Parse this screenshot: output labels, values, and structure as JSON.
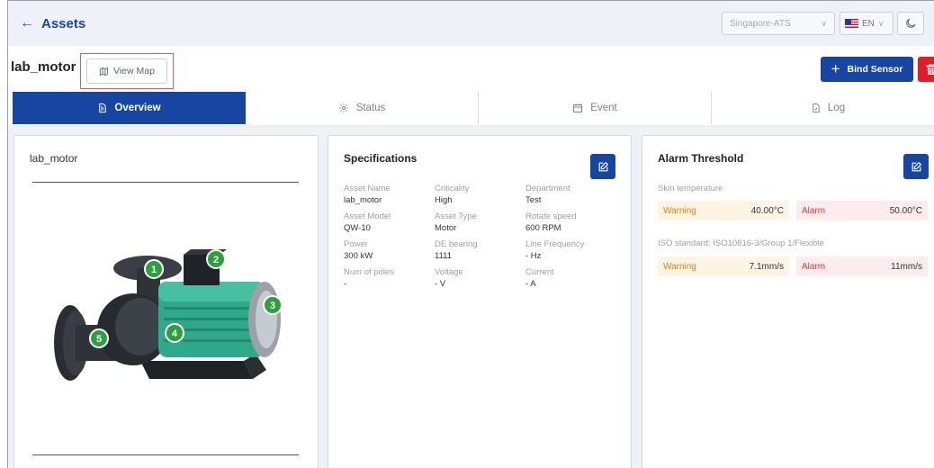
{
  "header": {
    "back_label": "Assets",
    "site_select": "Singapore-ATS",
    "lang_select": "EN"
  },
  "asset": {
    "name": "lab_motor",
    "view_map_label": "View Map"
  },
  "actions": {
    "bind_sensor_label": "Bind Sensor"
  },
  "tabs": [
    {
      "label": "Overview",
      "icon": "document-icon",
      "active": true
    },
    {
      "label": "Status",
      "icon": "gear-icon",
      "active": false
    },
    {
      "label": "Event",
      "icon": "calendar-icon",
      "active": false
    },
    {
      "label": "Log",
      "icon": "file-icon",
      "active": false
    }
  ],
  "image_card": {
    "title": "lab_motor",
    "markers": [
      "1",
      "2",
      "3",
      "4",
      "5"
    ]
  },
  "specifications": {
    "title": "Specifications",
    "items": [
      {
        "label": "Asset Name",
        "value": "lab_motor"
      },
      {
        "label": "Criticality",
        "value": "High"
      },
      {
        "label": "Department",
        "value": "Test"
      },
      {
        "label": "Asset Model",
        "value": "QW-10"
      },
      {
        "label": "Asset Type",
        "value": "Motor"
      },
      {
        "label": "Rotate speed",
        "value": "600 RPM"
      },
      {
        "label": "Power",
        "value": "300 kW"
      },
      {
        "label": "DE bearing",
        "value": "1111"
      },
      {
        "label": "Line Frequency",
        "value": "- Hz"
      },
      {
        "label": "Num of poles",
        "value": "-"
      },
      {
        "label": "Voltage",
        "value": "- V"
      },
      {
        "label": "Current",
        "value": "- A"
      }
    ]
  },
  "alarm_threshold": {
    "title": "Alarm Threshold",
    "groups": [
      {
        "label": "Skin temperature",
        "warning_label": "Warning",
        "warning_value": "40.00°C",
        "alarm_label": "Alarm",
        "alarm_value": "50.00°C"
      },
      {
        "label": "ISO standard: ISO10816-3/Group 1/Flexible",
        "warning_label": "Warning",
        "warning_value": "7.1mm/s",
        "alarm_label": "Alarm",
        "alarm_value": "11mm/s"
      }
    ]
  },
  "colors": {
    "primary": "#1746a2",
    "danger": "#e11d2a",
    "warning_bg": "#fdf4e4",
    "alarm_bg": "#fdeced"
  }
}
